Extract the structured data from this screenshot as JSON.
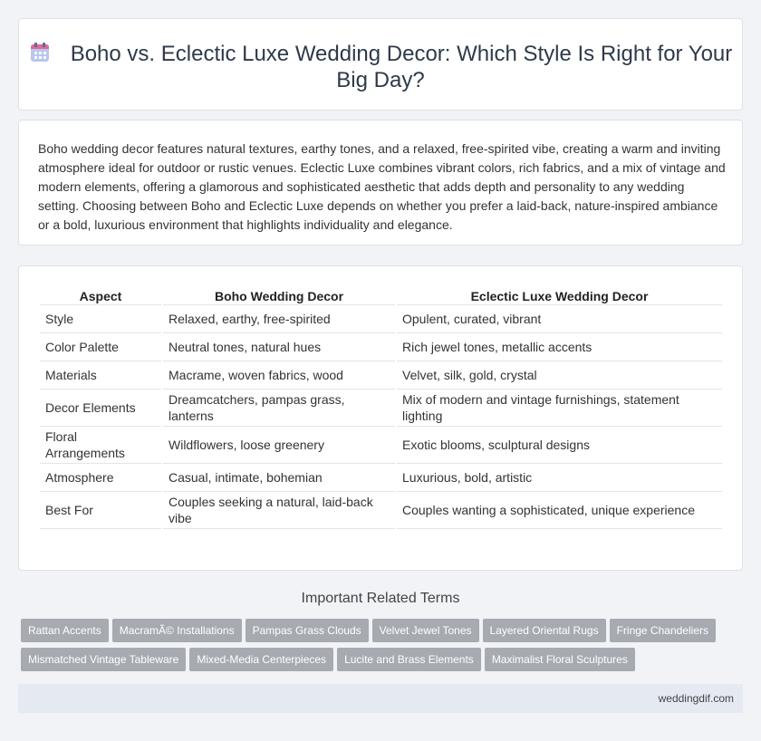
{
  "header": {
    "title": "Boho vs. Eclectic Luxe Wedding Decor: Which Style Is Right for Your Big Day?",
    "icon": "calendar-icon"
  },
  "intro": {
    "text": "Boho wedding decor features natural textures, earthy tones, and a relaxed, free-spirited vibe, creating a warm and inviting atmosphere ideal for outdoor or rustic venues. Eclectic Luxe combines vibrant colors, rich fabrics, and a mix of vintage and modern elements, offering a glamorous and sophisticated aesthetic that adds depth and personality to any wedding setting. Choosing between Boho and Eclectic Luxe depends on whether you prefer a laid-back, nature-inspired ambiance or a bold, luxurious environment that highlights individuality and elegance."
  },
  "comparison": {
    "headers": [
      "Aspect",
      "Boho Wedding Decor",
      "Eclectic Luxe Wedding Decor"
    ],
    "rows": [
      [
        "Style",
        "Relaxed, earthy, free-spirited",
        "Opulent, curated, vibrant"
      ],
      [
        "Color Palette",
        "Neutral tones, natural hues",
        "Rich jewel tones, metallic accents"
      ],
      [
        "Materials",
        "Macrame, woven fabrics, wood",
        "Velvet, silk, gold, crystal"
      ],
      [
        "Decor Elements",
        "Dreamcatchers, pampas grass, lanterns",
        "Mix of modern and vintage furnishings, statement lighting"
      ],
      [
        "Floral Arrangements",
        "Wildflowers, loose greenery",
        "Exotic blooms, sculptural designs"
      ],
      [
        "Atmosphere",
        "Casual, intimate, bohemian",
        "Luxurious, bold, artistic"
      ],
      [
        "Best For",
        "Couples seeking a natural, laid-back vibe",
        "Couples wanting a sophisticated, unique experience"
      ]
    ]
  },
  "related": {
    "title": "Important Related Terms",
    "tags": [
      "Rattan Accents",
      "MacramÃ© Installations",
      "Pampas Grass Clouds",
      "Velvet Jewel Tones",
      "Layered Oriental Rugs",
      "Fringe Chandeliers",
      "Mismatched Vintage Tableware",
      "Mixed-Media Centerpieces",
      "Lucite and Brass Elements",
      "Maximalist Floral Sculptures"
    ]
  },
  "footer": {
    "site": "weddingdif.com"
  }
}
